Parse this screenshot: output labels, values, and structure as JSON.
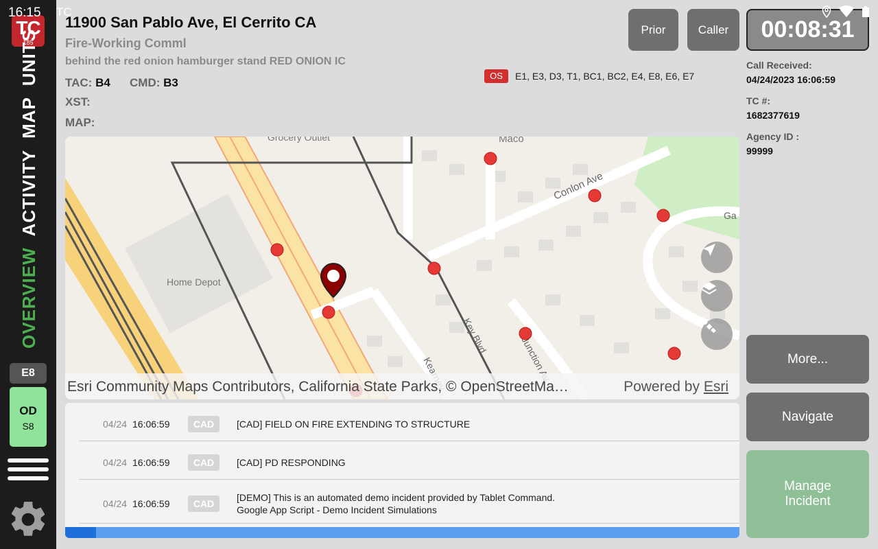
{
  "status_bar": {
    "time": "16:15",
    "app": "TC"
  },
  "sidebar": {
    "logo_text": "TC",
    "logo_number": "185",
    "nav": [
      "OVERVIEW",
      "ACTIVITY",
      "MAP",
      "UNITS"
    ],
    "active_nav": "OVERVIEW",
    "unit_badge": "E8",
    "unit_status": "OD",
    "unit_sub": "S8"
  },
  "incident": {
    "address": "11900 San Pablo Ave, El Cerrito CA",
    "type": "Fire-Working Comml",
    "location_note": "behind the red onion hamburger stand RED ONION IC",
    "tac_label": "TAC:",
    "tac_value": "B4",
    "cmd_label": "CMD:",
    "cmd_value": "B3",
    "xst_label": "XST:",
    "map_label": "MAP:",
    "os_badge": "OS",
    "units": "E1, E3, D3, T1, BC1, BC2, E4, E8, E6, E7"
  },
  "header_buttons": {
    "prior": "Prior",
    "caller": "Caller"
  },
  "timer": "00:08:31",
  "info": {
    "call_received_label": "Call Received:",
    "call_received_value": "04/24/2023 16:06:59",
    "tc_label": "TC #:",
    "tc_value": "1682377619",
    "agency_label": "Agency ID :",
    "agency_value": "99999"
  },
  "side_buttons": {
    "more": "More...",
    "navigate": "Navigate",
    "manage": "Manage Incident"
  },
  "map": {
    "labels": {
      "grocery": "Grocery Outlet",
      "home_depot": "Home Depot",
      "macdonald": "Maco",
      "conlon": "Conlon Ave",
      "key_blvd": "Key Blvd",
      "junction": "Junction Av",
      "kearney": "Kearney",
      "ga": "Ga"
    },
    "attribution": "Esri Community Maps Contributors, California State Parks, © OpenStreetMa…",
    "powered_by": "Powered by",
    "esri": "Esri"
  },
  "activity_log": [
    {
      "date": "04/24",
      "time": "16:06:59",
      "tag": "CAD",
      "message": "[CAD] FIELD ON FIRE EXTENDING TO STRUCTURE"
    },
    {
      "date": "04/24",
      "time": "16:06:59",
      "tag": "CAD",
      "message": "[CAD] PD RESPONDING"
    },
    {
      "date": "04/24",
      "time": "16:06:59",
      "tag": "CAD",
      "message": "[DEMO] This is an automated demo incident provided by Tablet Command.",
      "message2": "Google App Script - Demo Incident Simulations"
    }
  ]
}
